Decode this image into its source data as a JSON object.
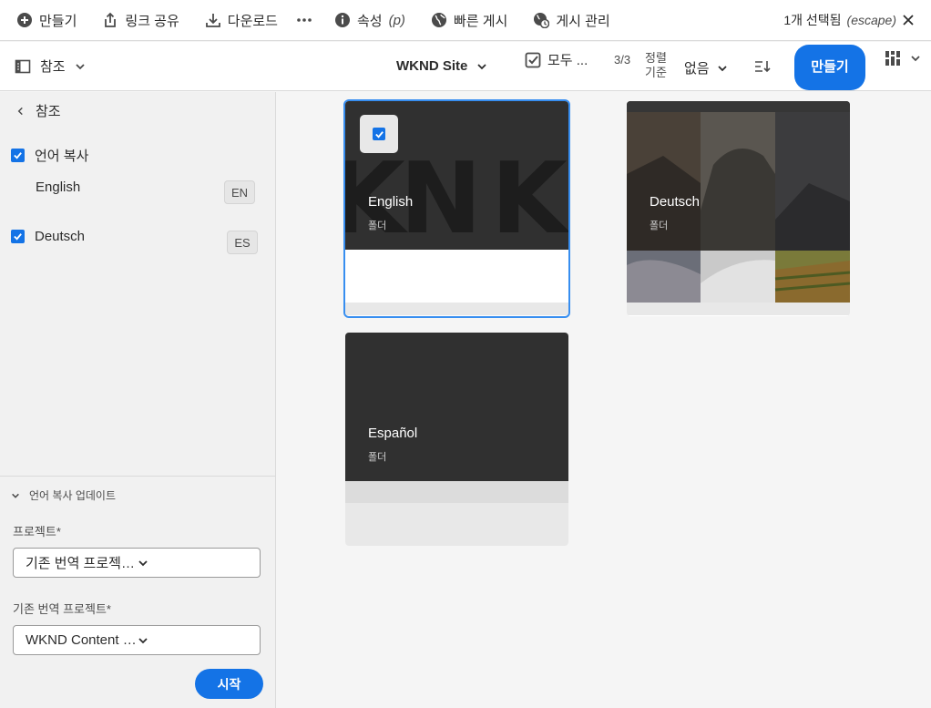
{
  "actionbar": {
    "items": [
      {
        "label": "만들기",
        "icon": "add-circle-icon"
      },
      {
        "label": "링크 공유",
        "icon": "share-icon"
      },
      {
        "label": "다운로드",
        "icon": "download-icon"
      },
      {
        "label": "",
        "icon": "more-icon"
      },
      {
        "label": "속성",
        "sub": "(p)",
        "icon": "info-icon"
      },
      {
        "label": "빠른 게시",
        "icon": "globe-icon"
      },
      {
        "label": "게시 관리",
        "icon": "globe-clock-icon"
      }
    ],
    "selection": {
      "text": "1개 선택됨",
      "hint": "(escape)"
    }
  },
  "toolbar": {
    "rail_label": "참조",
    "site": "WKND Site",
    "select_all": "모두 ...",
    "count": "3/3",
    "sort_label": "정렬 기준",
    "sort_value": "없음",
    "create": "만들기"
  },
  "rail": {
    "back_label": "참조",
    "language_copies": "언어 복사",
    "languages": [
      {
        "name": "English",
        "code": "EN",
        "checked": false
      },
      {
        "name": "Deutsch",
        "code": "ES",
        "checked": true
      }
    ],
    "update_section": "언어 복사 업데이트",
    "project_label": "프로젝트*",
    "project_value": "기존 번역 프로젝트에 추가",
    "existing_label": "기존 번역 프로젝트*",
    "existing_value": "WKND Content Fragment Tran...",
    "start": "시작"
  },
  "cards": [
    {
      "title": "English",
      "type": "폴더",
      "selected": true
    },
    {
      "title": "Deutsch",
      "type": "폴더",
      "selected": false
    },
    {
      "title": "Español",
      "type": "폴더",
      "selected": false
    }
  ],
  "colors": {
    "accent": "#1473e6",
    "selection": "#378ef0"
  }
}
